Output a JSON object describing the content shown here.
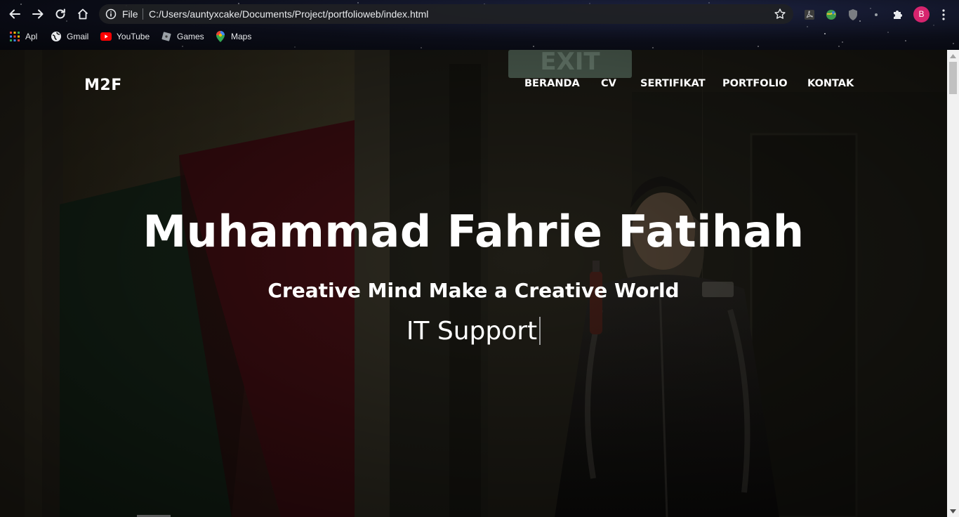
{
  "browser": {
    "omnibox": {
      "scheme_label": "File",
      "url": "C:/Users/auntyxcake/Documents/Project/portfolioweb/index.html"
    },
    "profile_initial": "B",
    "bookmarks": [
      {
        "label": "Apl",
        "icon": "apps-grid-icon"
      },
      {
        "label": "Gmail",
        "icon": "globe-icon"
      },
      {
        "label": "YouTube",
        "icon": "youtube-icon"
      },
      {
        "label": "Games",
        "icon": "games-icon"
      },
      {
        "label": "Maps",
        "icon": "maps-pin-icon"
      }
    ]
  },
  "site": {
    "brand": "M2F",
    "nav": [
      {
        "label": "BERANDA"
      },
      {
        "label": "CV"
      },
      {
        "label": "SERTIFIKAT"
      },
      {
        "label": "PORTFOLIO"
      },
      {
        "label": "KONTAK"
      }
    ],
    "hero": {
      "name": "Muhammad Fahrie Fatihah",
      "tagline": "Creative Mind Make a Creative World",
      "role": "IT Support"
    }
  },
  "colors": {
    "avatar": "#d6246e",
    "text": "#ffffff",
    "omnibox_bg": "#202124"
  }
}
